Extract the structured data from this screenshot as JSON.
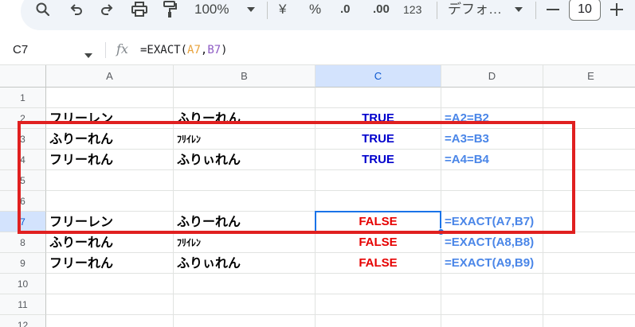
{
  "toolbar": {
    "zoom": "100%",
    "currency_symbol": "¥",
    "percent_symbol": "%",
    "decrease_decimal_label": ".0",
    "increase_decimal_label": ".00",
    "more_formats_label": "123",
    "font_name": "デフォ…",
    "font_size": "10",
    "icons": [
      "search-icon",
      "undo-icon",
      "redo-icon",
      "print-icon",
      "paint-format-icon",
      "chevron-down-icon",
      "minus-icon",
      "plus-icon"
    ]
  },
  "formula_bar": {
    "cell_ref": "C7",
    "fx_label": "fx",
    "formula": {
      "prefix": "=EXACT(",
      "ref1": "A7",
      "sep": ",",
      "ref2": "B7",
      "suffix": ")"
    }
  },
  "columns": [
    "A",
    "B",
    "C",
    "D",
    "E"
  ],
  "selected_column": "C",
  "rows": [
    {
      "num": "1",
      "A": "",
      "B": "",
      "C": "",
      "D": ""
    },
    {
      "num": "2",
      "A": "フリーレン",
      "B": "ふりーれん",
      "C": "TRUE",
      "D": "=A2=B2"
    },
    {
      "num": "3",
      "A": "ふりーれん",
      "B": "ﾌﾘｲﾚﾝ",
      "C": "TRUE",
      "D": "=A3=B3"
    },
    {
      "num": "4",
      "A": "フリーれん",
      "B": "ふりぃれん",
      "C": "TRUE",
      "D": "=A4=B4"
    },
    {
      "num": "5",
      "A": "",
      "B": "",
      "C": "",
      "D": ""
    },
    {
      "num": "6",
      "A": "",
      "B": "",
      "C": "",
      "D": ""
    },
    {
      "num": "7",
      "A": "フリーレン",
      "B": "ふりーれん",
      "C": "FALSE",
      "D": "=EXACT(A7,B7)"
    },
    {
      "num": "8",
      "A": "ふりーれん",
      "B": "ﾌﾘｲﾚﾝ",
      "C": "FALSE",
      "D": "=EXACT(A8,B8)"
    },
    {
      "num": "9",
      "A": "フリーれん",
      "B": "ふりぃれん",
      "C": "FALSE",
      "D": "=EXACT(A9,B9)"
    },
    {
      "num": "10",
      "A": "",
      "B": "",
      "C": "",
      "D": ""
    },
    {
      "num": "11",
      "A": "",
      "B": "",
      "C": "",
      "D": ""
    },
    {
      "num": "12",
      "A": "",
      "B": "",
      "C": "",
      "D": ""
    }
  ],
  "selected_row": "7",
  "active_cell": "C7",
  "colors": {
    "true_text": "#0000cc",
    "false_text": "#e60000",
    "formula_text": "#4a86e8",
    "highlight_border": "#e02020",
    "selection": "#1a73e8"
  }
}
